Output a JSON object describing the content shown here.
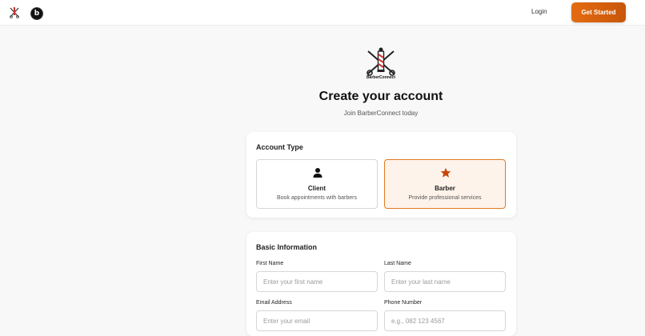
{
  "topbar": {
    "login_label": "Login",
    "get_started_label": "Get Started",
    "badge_letter": "b"
  },
  "hero": {
    "logo_text": "BarberConnect",
    "title": "Create your account",
    "subtitle": "Join BarberConnect today"
  },
  "account_type": {
    "heading": "Account Type",
    "options": [
      {
        "label": "Client",
        "description": "Book appointments with barbers",
        "icon": "user-icon",
        "selected": false
      },
      {
        "label": "Barber",
        "description": "Provide professional services",
        "icon": "star-icon",
        "selected": true
      }
    ]
  },
  "basic_info": {
    "heading": "Basic Information",
    "first_name": {
      "label": "First Name",
      "placeholder": "Enter your first name",
      "value": ""
    },
    "last_name": {
      "label": "Last Name",
      "placeholder": "Enter your last name",
      "value": ""
    },
    "email": {
      "label": "Email Address",
      "placeholder": "Enter your email",
      "value": ""
    },
    "phone": {
      "label": "Phone Number",
      "placeholder": "e.g., 082 123 4567",
      "value": ""
    }
  },
  "colors": {
    "accent": "#e07a22",
    "button_gradient_start": "#e46b10",
    "button_gradient_end": "#c8560a",
    "selected_bg": "#fdf3ea"
  }
}
